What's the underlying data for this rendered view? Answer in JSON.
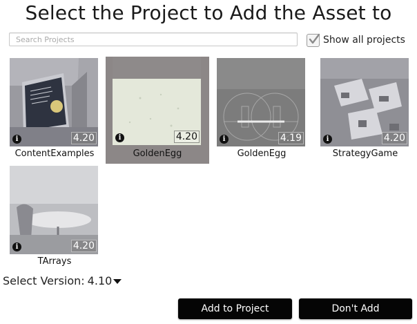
{
  "title": "Select the Project to Add the Asset to",
  "search": {
    "placeholder": "Search Projects",
    "value": ""
  },
  "show_all": {
    "label": "Show all projects",
    "checked": true
  },
  "projects": [
    {
      "name": "ContentExamples",
      "version": "4.20",
      "selected": false
    },
    {
      "name": "GoldenEgg",
      "version": "4.20",
      "selected": true
    },
    {
      "name": "GoldenEgg",
      "version": "4.19",
      "selected": false
    },
    {
      "name": "StrategyGame",
      "version": "4.20",
      "selected": false
    },
    {
      "name": "TArrays",
      "version": "4.20",
      "selected": false
    }
  ],
  "version_select": {
    "label": "Select Version:",
    "value": "4.10"
  },
  "buttons": {
    "add": "Add to Project",
    "dont_add": "Don't Add"
  },
  "colors": {
    "selected_tile": "#8c8787",
    "button_bg": "#050505",
    "button_text": "#ffffff"
  }
}
